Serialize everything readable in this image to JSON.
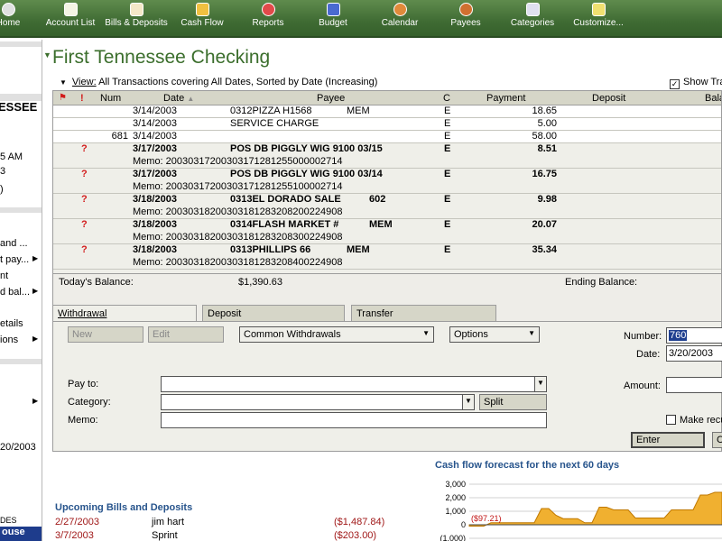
{
  "toolbar": {
    "items": [
      {
        "label": "Home",
        "icon": "home-icon"
      },
      {
        "label": "Account List",
        "icon": "account-list-icon"
      },
      {
        "label": "Bills & Deposits",
        "icon": "bills-deposits-icon"
      },
      {
        "label": "Cash Flow",
        "icon": "cash-flow-icon"
      },
      {
        "label": "Reports",
        "icon": "reports-icon"
      },
      {
        "label": "Budget",
        "icon": "budget-icon"
      },
      {
        "label": "Calendar",
        "icon": "calendar-icon"
      },
      {
        "label": "Payees",
        "icon": "payees-icon"
      },
      {
        "label": "Categories",
        "icon": "categories-icon"
      },
      {
        "label": "Customize...",
        "icon": "customize-icon"
      }
    ]
  },
  "sidebar": {
    "bank_fragment": "ESSEE",
    "time_fragment": "5 AM",
    "line2": "3",
    "line3": ")",
    "links": [
      "and ...",
      "t pay...",
      "nt",
      "d bal...",
      "etails",
      "ions"
    ],
    "date_fragment": "20/2003",
    "footer_fragment": "DES",
    "footer_fragment2": "ouse"
  },
  "account": {
    "title": "First Tennessee Checking",
    "view_label": "View:",
    "view_desc": "All Transactions covering All Dates, Sorted by Date (Increasing)",
    "show_label": "Show Tra"
  },
  "register": {
    "headers": {
      "num": "Num",
      "date": "Date",
      "payee": "Payee",
      "c": "C",
      "payment": "Payment",
      "deposit": "Deposit",
      "balance": "Bala"
    },
    "rows": [
      {
        "num": "",
        "date": "3/14/2003",
        "payee": "0312PIZZA H1568",
        "payee_extra": "MEM",
        "c": "E",
        "payment": "18.65",
        "deposit": "",
        "bold": false,
        "flag": "",
        "memo": ""
      },
      {
        "num": "",
        "date": "3/14/2003",
        "payee": "SERVICE CHARGE",
        "payee_extra": "",
        "c": "E",
        "payment": "5.00",
        "deposit": "",
        "bold": false,
        "flag": "",
        "memo": ""
      },
      {
        "num": "681",
        "date": "3/14/2003",
        "payee": "",
        "payee_extra": "",
        "c": "E",
        "payment": "58.00",
        "deposit": "",
        "bold": false,
        "flag": "",
        "memo": ""
      },
      {
        "num": "",
        "date": "3/17/2003",
        "payee": "POS DB   PIGGLY WIG 9100 03/15",
        "payee_extra": "",
        "c": "E",
        "payment": "8.51",
        "deposit": "",
        "bold": true,
        "flag": "?",
        "memo": "Memo: 20030317200303171281255000002714"
      },
      {
        "num": "",
        "date": "3/17/2003",
        "payee": "POS DB   PIGGLY WIG 9100 03/14",
        "payee_extra": "",
        "c": "E",
        "payment": "16.75",
        "deposit": "",
        "bold": true,
        "flag": "?",
        "memo": "Memo: 20030317200303171281255100002714"
      },
      {
        "num": "",
        "date": "3/18/2003",
        "payee": "0313EL DORADO SALE",
        "payee_extra": "602",
        "c": "E",
        "payment": "9.98",
        "deposit": "",
        "bold": true,
        "flag": "?",
        "memo": "Memo: 20030318200303181283208200224908"
      },
      {
        "num": "",
        "date": "3/18/2003",
        "payee": "0314FLASH MARKET #",
        "payee_extra": "MEM",
        "c": "E",
        "payment": "20.07",
        "deposit": "",
        "bold": true,
        "flag": "?",
        "memo": "Memo: 20030318200303181283208300224908"
      },
      {
        "num": "",
        "date": "3/18/2003",
        "payee": "0313PHILLIPS 66",
        "payee_extra": "MEM",
        "c": "E",
        "payment": "35.34",
        "deposit": "",
        "bold": true,
        "flag": "?",
        "memo": "Memo: 20030318200303181283208400224908"
      }
    ],
    "todays_balance_label": "Today's Balance:",
    "todays_balance": "$1,390.63",
    "ending_balance_label": "Ending Balance:"
  },
  "entry": {
    "tabs": [
      "Withdrawal",
      "Deposit",
      "Transfer"
    ],
    "new_label": "New",
    "edit_label": "Edit",
    "common_label": "Common Withdrawals",
    "options_label": "Options",
    "number_label": "Number:",
    "number_value": "760",
    "date_label": "Date:",
    "date_value": "3/20/2003",
    "payto_label": "Pay to:",
    "category_label": "Category:",
    "split_label": "Split",
    "memo_label": "Memo:",
    "amount_label": "Amount:",
    "make_recurring_label": "Make recu",
    "enter_label": "Enter",
    "cancel_fragment": "C"
  },
  "forecast": {
    "title": "Cash flow forecast for the next 60 days",
    "y_ticks": [
      "3,000",
      "2,000",
      "1,000",
      "0",
      "(1,000)"
    ],
    "low_label": "($97.21)"
  },
  "upcoming": {
    "title": "Upcoming Bills and Deposits",
    "items": [
      {
        "date": "2/27/2003",
        "payee": "jim hart",
        "amount": "($1,487.84)"
      },
      {
        "date": "3/7/2003",
        "payee": "Sprint",
        "amount": "($203.00)"
      }
    ]
  },
  "chart_data": {
    "type": "area",
    "title": "Cash flow forecast for the next 60 days",
    "xlabel": "",
    "ylabel": "",
    "ylim": [
      -1000,
      3000
    ],
    "y_ticks": [
      3000,
      2000,
      1000,
      0,
      -1000
    ],
    "values": [
      -97.21,
      -97.21,
      -97.21,
      150,
      150,
      150,
      150,
      150,
      150,
      150,
      1200,
      1200,
      700,
      450,
      450,
      450,
      150,
      150,
      1300,
      1300,
      1100,
      1100,
      1100,
      500,
      500,
      500,
      500,
      500,
      1100,
      1100,
      1100,
      1100,
      2200,
      2200,
      2400,
      2400
    ],
    "colors": {
      "fill": "#f0b030",
      "line": "#c07800"
    },
    "grid": true
  },
  "colors": {
    "toolbar": "#3f6b33",
    "title_green": "#3b6e2c",
    "link_blue": "#27548c",
    "red": "#d21b1b"
  }
}
